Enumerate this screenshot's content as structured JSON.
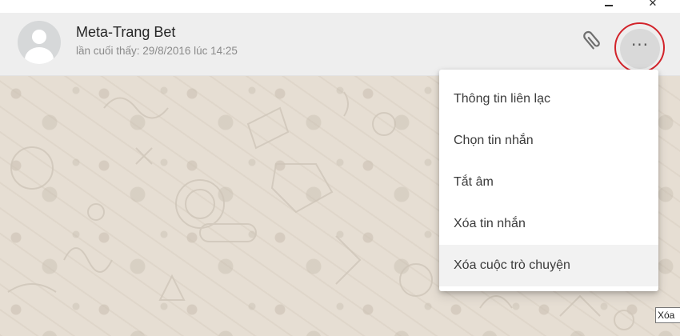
{
  "window": {
    "minimize_icon": "minimize-icon",
    "close_icon": "close-icon",
    "close_glyph": "✕"
  },
  "header": {
    "contact_name": "Meta-Trang Bet",
    "last_seen": "lần cuối thấy: 29/8/2016 lúc 14:25",
    "attach_icon": "paperclip-icon",
    "menu_icon": "more-options-icon",
    "menu_glyph": "···",
    "highlight_color": "#d2232a"
  },
  "menu": {
    "items": [
      {
        "label": "Thông tin liên lạc"
      },
      {
        "label": "Chọn tin nhắn"
      },
      {
        "label": "Tắt âm"
      },
      {
        "label": "Xóa tin nhắn"
      },
      {
        "label": "Xóa cuộc trò chuyện",
        "hovered": true
      }
    ]
  },
  "tooltip": {
    "text": "Xóa"
  },
  "colors": {
    "header_bg": "#eeeeee",
    "chat_bg": "#e6ded3",
    "menu_bg": "#ffffff"
  }
}
